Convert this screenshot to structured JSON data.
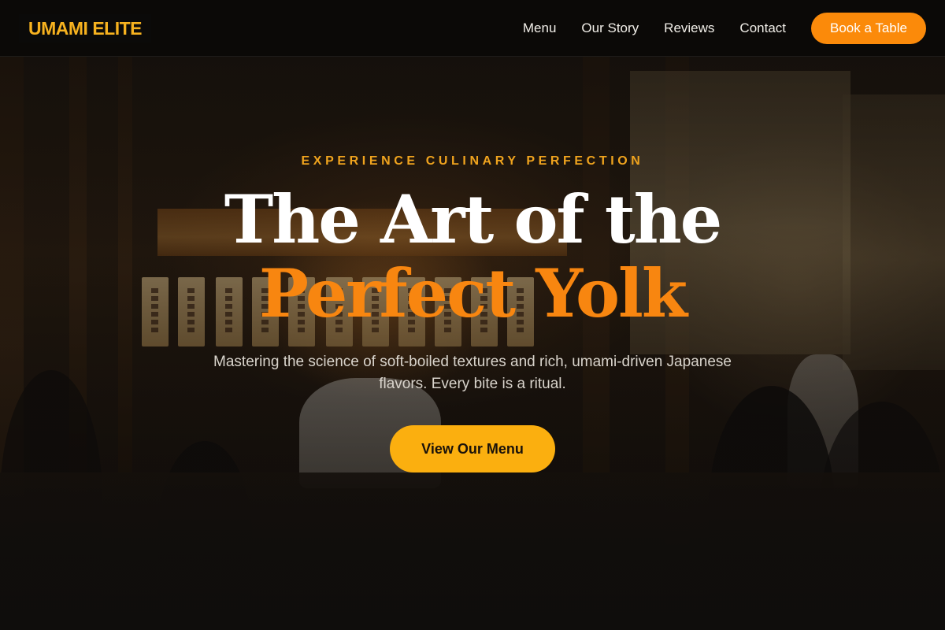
{
  "brand": {
    "name": "UMAMI ELITE",
    "accent": "#f7b21f"
  },
  "nav": {
    "links": [
      {
        "label": "Menu"
      },
      {
        "label": "Our Story"
      },
      {
        "label": "Reviews"
      },
      {
        "label": "Contact"
      }
    ],
    "cta_label": "Book a Table",
    "cta_color": "#fb8a0a"
  },
  "hero": {
    "eyebrow": "EXPERIENCE CULINARY PERFECTION",
    "headline_line1": "The Art of the",
    "headline_line2": "Perfect Yolk",
    "headline_accent": "#f88610",
    "subtitle": "Mastering the science of soft-boiled textures and rich, umami-driven Japanese flavors. Every bite is a ritual.",
    "cta_label": "View Our Menu",
    "cta_color": "#fbaf0f"
  }
}
